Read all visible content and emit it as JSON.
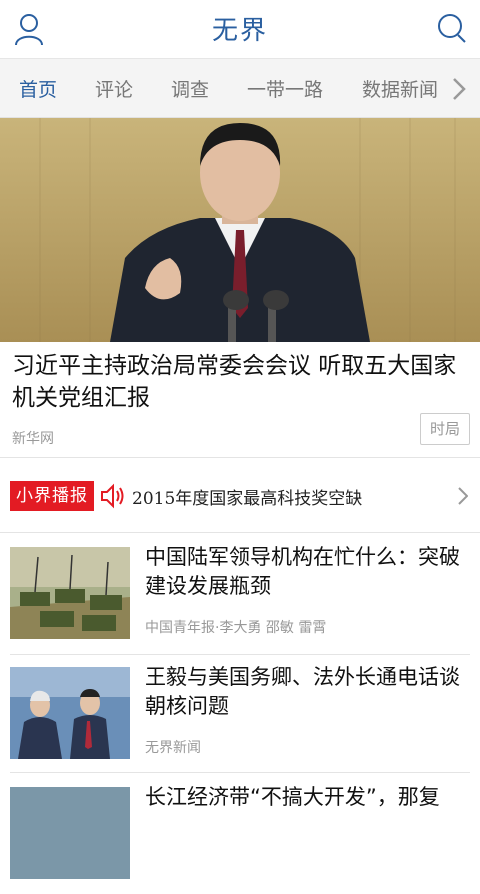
{
  "header": {
    "title": "无界"
  },
  "tabs": [
    "首页",
    "评论",
    "调查",
    "一带一路",
    "数据新闻"
  ],
  "hero": {
    "title": "习近平主持政治局常委会会议 听取五大国家机关党组汇报",
    "source": "新华网",
    "tag": "时局"
  },
  "broadcast": {
    "logo": "小界播报",
    "text": "2015年度国家最高科技奖空缺"
  },
  "news": [
    {
      "title": "中国陆军领导机构在忙什么：突破建设发展瓶颈",
      "source": "中国青年报·李大勇 邵敏 雷霄"
    },
    {
      "title": "王毅与美国务卿、法外长通电话谈朝核问题",
      "source": "无界新闻"
    },
    {
      "title": "长江经济带“不搞大开发”，那复",
      "source": ""
    }
  ],
  "colors": {
    "accent": "#2a5fa0",
    "broadcast_red": "#e31b23"
  },
  "icons": {
    "user": "user-icon",
    "search": "search-icon",
    "more": "chevron-right-icon",
    "speaker": "speaker-icon"
  }
}
